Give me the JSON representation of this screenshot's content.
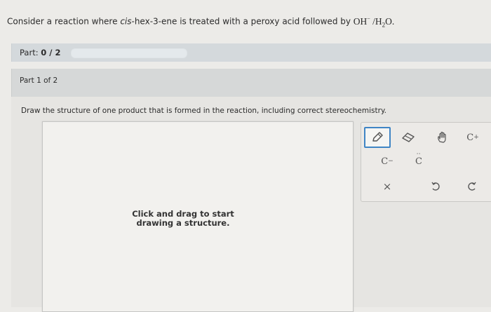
{
  "question": {
    "prefix": "Consider a reaction where ",
    "compound": "cis",
    "compound_rest": "-hex-3-ene is treated with a peroxy acid followed by ",
    "reagent_main": "OH",
    "reagent_sup": "−",
    "reagent_sep": " /H",
    "reagent_sub": "2",
    "reagent_end": "O."
  },
  "part": {
    "label": "Part:",
    "value": "0 / 2",
    "progress_fraction": 0
  },
  "subpart": {
    "header": "Part 1 of 2",
    "instruction": "Draw the structure of one product that is formed in the reaction, including correct stereochemistry."
  },
  "canvas": {
    "hint": "Click and drag to start drawing a structure."
  },
  "tools": {
    "carbanion_label": "C",
    "carbanion_sup": "−",
    "carbene_label": "C",
    "carbocation_label": "C",
    "carbocation_sup": "+",
    "clear_label": "×"
  },
  "colors": {
    "accent": "#3f85c5",
    "panel": "#d4d9dc"
  }
}
